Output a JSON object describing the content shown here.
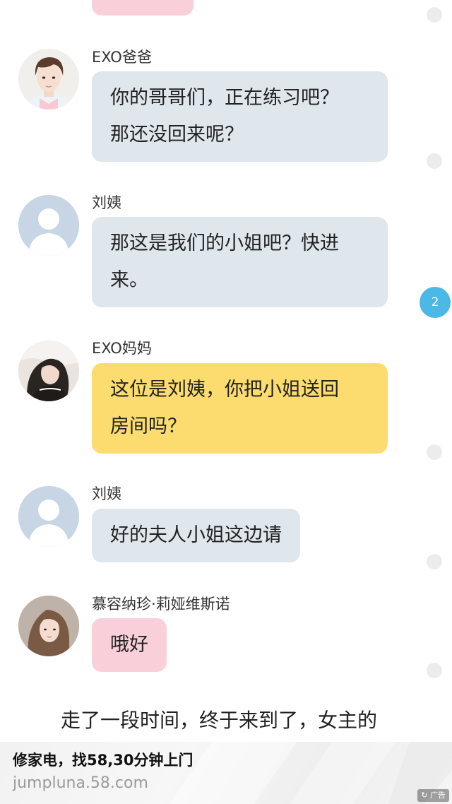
{
  "messages": [
    {
      "sender": "EXO爸爸",
      "line1": "你的哥哥们，正在练习吧？",
      "line2": "那还没回来呢？",
      "color": "#dfe6ec"
    },
    {
      "sender": "刘姨",
      "line1": "那这是我们的小姐吧？快进",
      "line2": "来。",
      "color": "#dfe6ec"
    },
    {
      "sender": "EXO妈妈",
      "line1": "这位是刘姨，你把小姐送回",
      "line2": "房间吗？",
      "color": "#fcdc6f"
    },
    {
      "sender": "刘姨",
      "text": "好的夫人小姐这边请",
      "color": "#dfe6ec"
    },
    {
      "sender": "慕容纳珍·莉娅维斯诺",
      "text": "哦好",
      "color": "#f9d0da"
    }
  ],
  "unread_badge": "2",
  "narration": "走了一段时间，终于来到了，女主的",
  "ad": {
    "title": "修家电，找58,30分钟上门",
    "url": "jumpluna.58.com",
    "tag_icon": "refresh-icon",
    "tag_text": "广告"
  },
  "icons": [
    "male-avatar",
    "default-user-avatar",
    "female-avatar",
    "refresh-icon"
  ]
}
